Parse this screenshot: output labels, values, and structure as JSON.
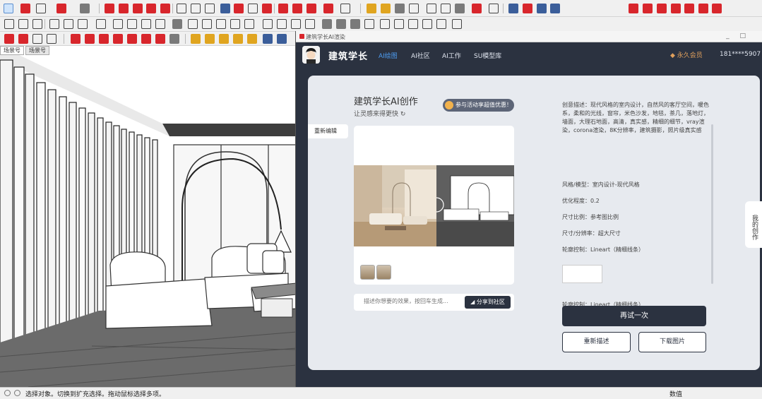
{
  "viewport": {
    "scene_tabs": [
      "场景号",
      "场景号"
    ]
  },
  "plugin": {
    "window_title": "建筑学长AI渲染",
    "window_controls": "_ □",
    "brand": "建筑学长",
    "nav": [
      "AI绘图",
      "AI社区",
      "AI工作",
      "SU模型库"
    ],
    "vip": "永久会员",
    "phone": "181****5907",
    "card": {
      "title": "建筑学长AI创作",
      "subtitle": "让灵感来得更快 ↻",
      "promo": "参与活动享超值优惠！ ›",
      "side_tab": "重新编辑",
      "prompt_placeholder": "描述你想要的效果，按回车生成...",
      "send_label": "分享到社区",
      "info": {
        "description": "创意描述：现代风格的室内设计，自然风的客厅空间，暖色系，柔和的光线，窗帘，米色沙发，地毯，茶几，落地灯，墙面，大理石地面，高清，真实感，精细的细节，vray渲染，corona渲染，8K分辨率，建筑摄影，照片级真实感",
        "style": "风格/模型：室内设计-现代风格",
        "strength": "优化程度：0.2",
        "ratio": "尺寸比例：参考图比例",
        "resolution": "尺寸/分辨率：超大尺寸",
        "lineart1": "轮廓控制：Lineart（精细线条）",
        "lineart2": "轮廓控制：Lineart（精细线条）"
      },
      "retry_label": "再试一次",
      "redesc_label": "重新描述",
      "download_label": "下载图片"
    },
    "my_works": "我的创作"
  },
  "status": {
    "text": "选择对象。切换到扩充选择。拖动鼠标选择多项。",
    "right": "数值"
  },
  "colors": {
    "plugin_bg": "#2b3240",
    "card_bg": "#e7eaef",
    "accent": "#4d9cf0",
    "vip": "#e0a05c"
  }
}
